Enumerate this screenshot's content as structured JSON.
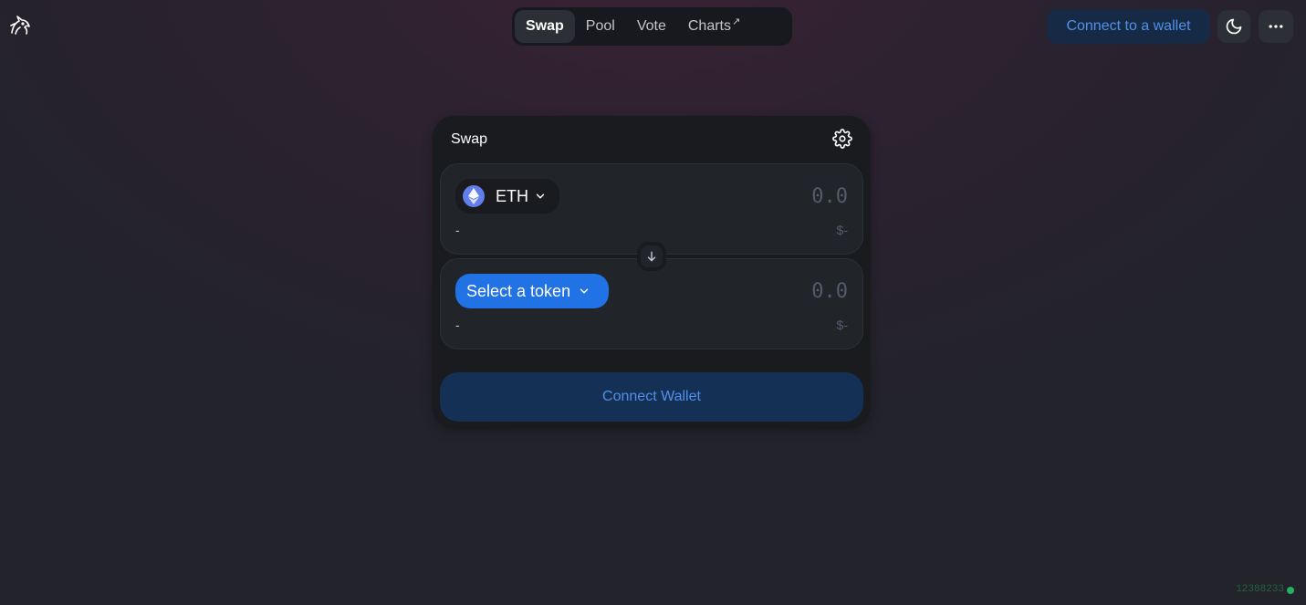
{
  "header": {
    "logo_icon": "unicorn-logo-icon",
    "nav": [
      {
        "label": "Swap",
        "active": true
      },
      {
        "label": "Pool",
        "active": false
      },
      {
        "label": "Vote",
        "active": false
      },
      {
        "label": "Charts",
        "active": false,
        "external_marker": "↗"
      }
    ],
    "connect_label": "Connect to a wallet",
    "theme_icon": "moon-icon",
    "menu_icon": "more-dots-icon"
  },
  "swap": {
    "title": "Swap",
    "settings_icon": "gear-icon",
    "input": {
      "token_symbol": "ETH",
      "token_icon": "eth-logo-icon",
      "amount_placeholder": "0.0",
      "balance": "-",
      "usd_value": "$-"
    },
    "switch_icon": "arrow-down-icon",
    "output": {
      "select_label": "Select a token",
      "amount_placeholder": "0.0",
      "balance": "-",
      "usd_value": "$-"
    },
    "connect_wallet_label": "Connect Wallet"
  },
  "footer": {
    "block_number": "12388233"
  },
  "colors": {
    "accent": "#2172e5",
    "connect_text": "#5090ea",
    "status_ok": "#27ae60"
  }
}
